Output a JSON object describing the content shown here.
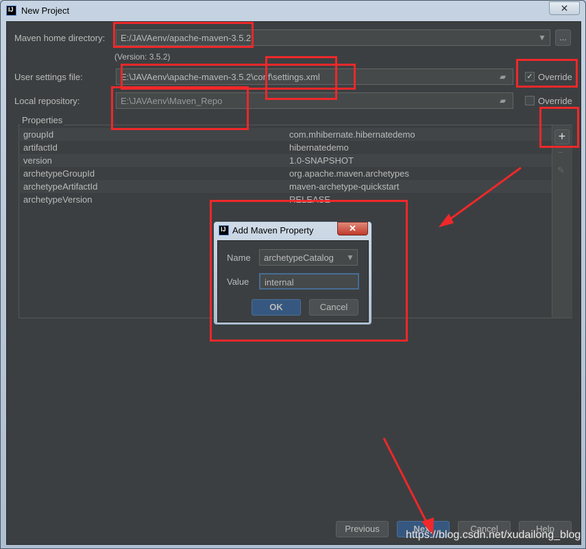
{
  "window": {
    "title": "New Project",
    "close": "✕",
    "app_icon": "IJ"
  },
  "form": {
    "maven_home_label": "Maven home directory:",
    "maven_home_value": "E:/JAVAenv/apache-maven-3.5.2",
    "browse": "...",
    "version": "(Version: 3.5.2)",
    "user_settings_label": "User settings file:",
    "user_settings_value": "E:\\JAVAenv\\apache-maven-3.5.2\\conf\\settings.xml",
    "user_settings_override": "Override",
    "user_settings_checked": true,
    "local_repo_label": "Local repository:",
    "local_repo_value": "E:\\JAVAenv\\Maven_Repo",
    "local_repo_override": "Override",
    "local_repo_checked": false
  },
  "properties": {
    "title": "Properties",
    "rows": [
      {
        "key": "groupId",
        "value": "com.mhibernate.hibernatedemo"
      },
      {
        "key": "artifactId",
        "value": "hibernatedemo"
      },
      {
        "key": "version",
        "value": "1.0-SNAPSHOT"
      },
      {
        "key": "archetypeGroupId",
        "value": "org.apache.maven.archetypes"
      },
      {
        "key": "archetypeArtifactId",
        "value": "maven-archetype-quickstart"
      },
      {
        "key": "archetypeVersion",
        "value": "RELEASE"
      }
    ],
    "add": "+",
    "remove": "−",
    "edit": "✎"
  },
  "dialog": {
    "title": "Add Maven Property",
    "name_label": "Name",
    "name_value": "archetypeCatalog",
    "value_label": "Value",
    "value_value": "internal",
    "ok": "OK",
    "cancel": "Cancel",
    "close": "✕"
  },
  "footer": {
    "previous": "Previous",
    "next": "Next",
    "cancel": "Cancel",
    "help": "Help"
  },
  "watermark": "https://blog.csdn.net/xudailong_blog",
  "colors": {
    "background": "#3c3f41",
    "annotation": "#f0282a",
    "primary_button": "#365880"
  }
}
